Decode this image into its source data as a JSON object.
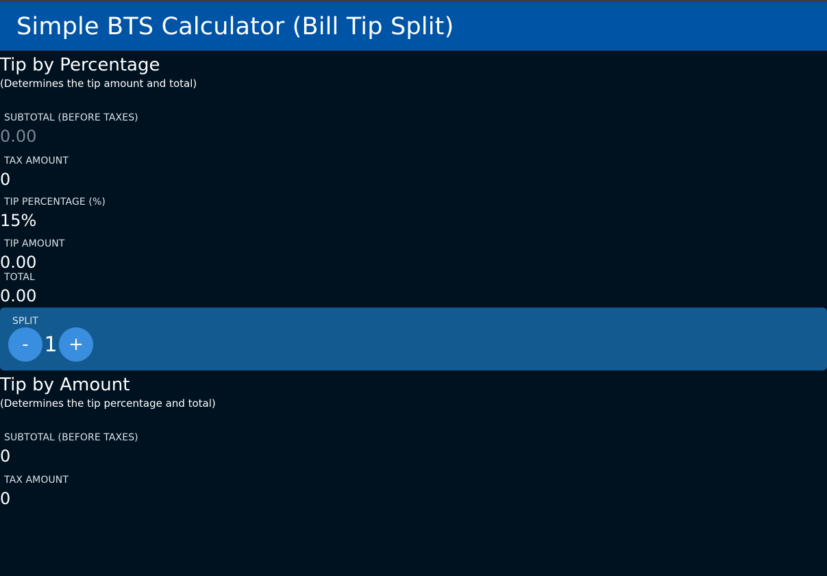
{
  "app": {
    "title": "Simple BTS Calculator (Bill Tip Split)"
  },
  "tip_by_percentage": {
    "title": "Tip by Percentage",
    "subtitle": "(Determines the tip amount and total)",
    "subtotal": {
      "label": "SUBTOTAL (BEFORE TAXES)",
      "value": "",
      "placeholder": "0.00"
    },
    "tax": {
      "label": "TAX AMOUNT",
      "value": "0"
    },
    "tip_percentage": {
      "label": "TIP PERCENTAGE (%)",
      "value": "15%"
    },
    "tip_amount": {
      "label": "TIP AMOUNT",
      "value": "0.00"
    },
    "total": {
      "label": "TOTAL",
      "value": "0.00"
    }
  },
  "split": {
    "label": "SPLIT",
    "decrement": "-",
    "count": "1",
    "increment": "+"
  },
  "tip_by_amount": {
    "title": "Tip by Amount",
    "subtitle": "(Determines the tip percentage and total)",
    "subtotal": {
      "label": "SUBTOTAL (BEFORE TAXES)",
      "value": "0"
    },
    "tax": {
      "label": "TAX AMOUNT",
      "value": "0"
    }
  },
  "colors": {
    "background": "#00111f",
    "app_bar": "#0054a6",
    "split_panel": "#125a8f",
    "round_button": "#3a8ee0"
  }
}
